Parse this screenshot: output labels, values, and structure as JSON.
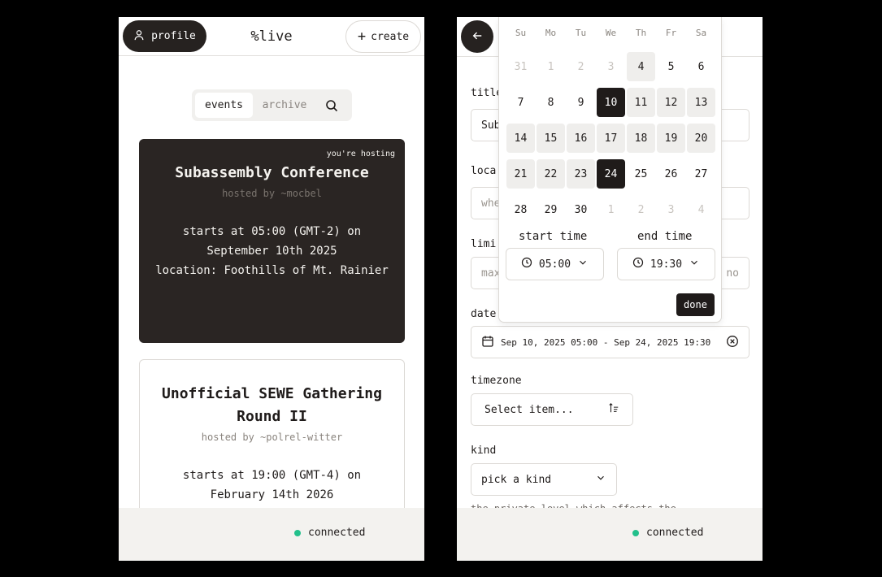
{
  "left": {
    "header": {
      "profile_label": "profile",
      "brand": "%live",
      "create_label": "create"
    },
    "tabs": {
      "events": "events",
      "archive": "archive"
    },
    "events": [
      {
        "hosting_tag": "you're hosting",
        "title": "Subassembly Conference",
        "host": "hosted by ~mocbel",
        "starts": "starts at 05:00 (GMT-2) on September 10th 2025",
        "location": "location: Foothills of Mt. Rainier"
      },
      {
        "title": "Unofficial SEWE Gathering Round II",
        "host": "hosted by ~polrel-witter",
        "starts": "starts at 19:00 (GMT-4) on February 14th 2026"
      }
    ],
    "status": "connected"
  },
  "right": {
    "form": {
      "title_label": "title",
      "title_value": "Sub",
      "location_label": "loca",
      "location_placeholder": "whe",
      "limit_label": "limi",
      "limit_placeholder": "max",
      "limit_suffix": "no",
      "dates_label": "date",
      "dates_value": "Sep 10, 2025 05:00 - Sep 24, 2025 19:30",
      "timezone_label": "timezone",
      "timezone_placeholder": "Select item...",
      "kind_label": "kind",
      "kind_placeholder": "pick a kind",
      "kind_help": "the private level which affects the"
    },
    "calendar": {
      "weekdays": [
        "Su",
        "Mo",
        "Tu",
        "We",
        "Th",
        "Fr",
        "Sa"
      ],
      "days": [
        [
          "31",
          "muted"
        ],
        [
          "1",
          "muted"
        ],
        [
          "2",
          "muted"
        ],
        [
          "3",
          "muted"
        ],
        [
          "4",
          "range"
        ],
        [
          "5",
          ""
        ],
        [
          "6",
          ""
        ],
        [
          "7",
          ""
        ],
        [
          "8",
          ""
        ],
        [
          "9",
          ""
        ],
        [
          "10",
          "sel"
        ],
        [
          "11",
          "range"
        ],
        [
          "12",
          "range"
        ],
        [
          "13",
          "range"
        ],
        [
          "14",
          "range"
        ],
        [
          "15",
          "range"
        ],
        [
          "16",
          "range"
        ],
        [
          "17",
          "range"
        ],
        [
          "18",
          "range"
        ],
        [
          "19",
          "range"
        ],
        [
          "20",
          "range"
        ],
        [
          "21",
          "range"
        ],
        [
          "22",
          "range"
        ],
        [
          "23",
          "range"
        ],
        [
          "24",
          "sel"
        ],
        [
          "25",
          ""
        ],
        [
          "26",
          ""
        ],
        [
          "27",
          ""
        ],
        [
          "28",
          ""
        ],
        [
          "29",
          ""
        ],
        [
          "30",
          ""
        ],
        [
          "1",
          "muted"
        ],
        [
          "2",
          "muted"
        ],
        [
          "3",
          "muted"
        ],
        [
          "4",
          "muted"
        ]
      ],
      "start_time_label": "start time",
      "start_time": "05:00",
      "end_time_label": "end time",
      "end_time": "19:30",
      "done_label": "done"
    },
    "status": "connected"
  }
}
